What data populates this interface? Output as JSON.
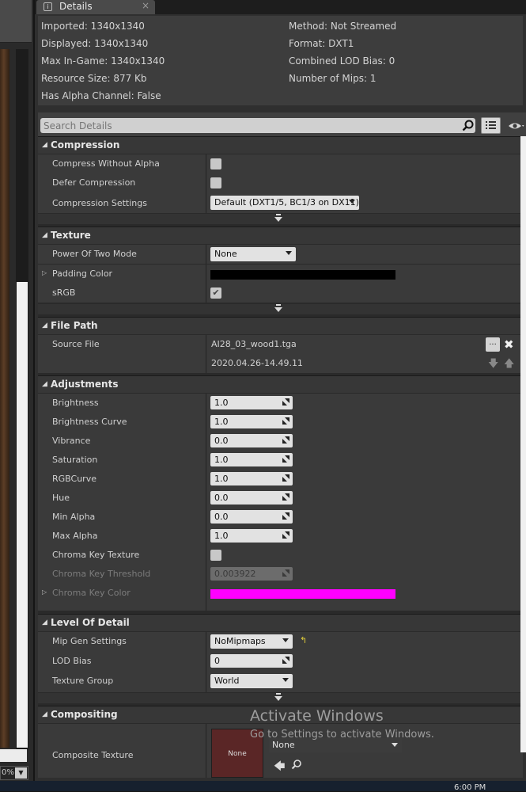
{
  "left_strip": {
    "zoom_label": "0%"
  },
  "tab": {
    "icon": "info-icon",
    "icon_text": "i",
    "label": "Details",
    "close": "×"
  },
  "info": {
    "left": [
      "Imported: 1340x1340",
      "Displayed: 1340x1340",
      "Max In-Game: 1340x1340",
      "Resource Size: 877 Kb",
      "Has Alpha Channel: False"
    ],
    "right": [
      "Method: Not Streamed",
      "Format: DXT1",
      "Combined LOD Bias: 0",
      "Number of Mips: 1"
    ]
  },
  "search": {
    "placeholder": "Search Details"
  },
  "categories": {
    "compression": "Compression",
    "texture": "Texture",
    "file_path": "File Path",
    "adjustments": "Adjustments",
    "lod": "Level Of Detail",
    "compositing": "Compositing"
  },
  "compression": {
    "compress_without_alpha": "Compress Without Alpha",
    "defer_compression": "Defer Compression",
    "compression_settings": "Compression Settings",
    "compression_settings_value": "Default (DXT1/5, BC1/3 on DX11)"
  },
  "texture": {
    "power_of_two_mode": "Power Of Two Mode",
    "power_of_two_value": "None",
    "padding_color": "Padding Color",
    "padding_color_value": "#000000",
    "srgb": "sRGB",
    "srgb_checked": true
  },
  "file_path": {
    "source_file": "Source File",
    "source_file_value": "AI28_03_wood1.tga",
    "timestamp": "2020.04.26-14.49.11",
    "browse_label": "..."
  },
  "adjustments": {
    "brightness": "Brightness",
    "brightness_value": "1.0",
    "brightness_curve": "Brightness Curve",
    "brightness_curve_value": "1.0",
    "vibrance": "Vibrance",
    "vibrance_value": "0.0",
    "saturation": "Saturation",
    "saturation_value": "1.0",
    "rgbcurve": "RGBCurve",
    "rgbcurve_value": "1.0",
    "hue": "Hue",
    "hue_value": "0.0",
    "min_alpha": "Min Alpha",
    "min_alpha_value": "0.0",
    "max_alpha": "Max Alpha",
    "max_alpha_value": "1.0",
    "chroma_key_texture": "Chroma Key Texture",
    "chroma_key_threshold": "Chroma Key Threshold",
    "chroma_key_threshold_value": "0.003922",
    "chroma_key_color": "Chroma Key Color",
    "chroma_key_color_value": "#ff00ff"
  },
  "lod": {
    "mip_gen_settings": "Mip Gen Settings",
    "mip_gen_value": "NoMipmaps",
    "lod_bias": "LOD Bias",
    "lod_bias_value": "0",
    "texture_group": "Texture Group",
    "texture_group_value": "World"
  },
  "compositing": {
    "composite_texture": "Composite Texture",
    "thumbnail_label": "None",
    "asset_value": "None"
  },
  "watermark": {
    "title": "Activate Windows",
    "subtitle": "Go to Settings to activate Windows."
  },
  "taskbar": {
    "clock": "6:00 PM"
  },
  "colors": {
    "panel_bg": "#2f2f2f",
    "category_bg": "#373737",
    "row_bg": "#3a3a3a"
  }
}
